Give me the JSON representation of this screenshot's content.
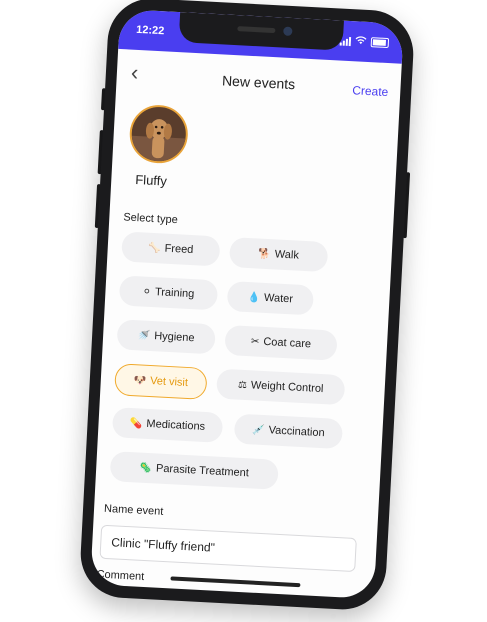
{
  "status_bar": {
    "time": "12:22"
  },
  "nav": {
    "back_icon": "chevron-left-icon",
    "title": "New events",
    "action": "Create"
  },
  "pet": {
    "name": "Fluffy"
  },
  "select_type": {
    "label": "Select type",
    "options": [
      {
        "label": "Freed",
        "icon": "🦴"
      },
      {
        "label": "Walk",
        "icon": "🐕"
      },
      {
        "label": "Training",
        "icon": "⚪"
      },
      {
        "label": "Water",
        "icon": "💧"
      },
      {
        "label": "Hygiene",
        "icon": "🚿"
      },
      {
        "label": "Coat care",
        "icon": "✂"
      },
      {
        "label": "Vet visit",
        "icon": "🐶",
        "selected": true
      },
      {
        "label": "Weight Control",
        "icon": "⚖"
      },
      {
        "label": "Medications",
        "icon": "💊"
      },
      {
        "label": "Vaccination",
        "icon": "💉"
      },
      {
        "label": "Parasite Treatment",
        "icon": "🦠"
      }
    ]
  },
  "name_event": {
    "label": "Name event",
    "value": "Clinic \"Fluffy friend\""
  },
  "comment": {
    "label": "Comment"
  },
  "colors": {
    "accent": "#4a3ef0",
    "selected": "#f0a92b",
    "chip_bg": "#f0f0f2"
  }
}
